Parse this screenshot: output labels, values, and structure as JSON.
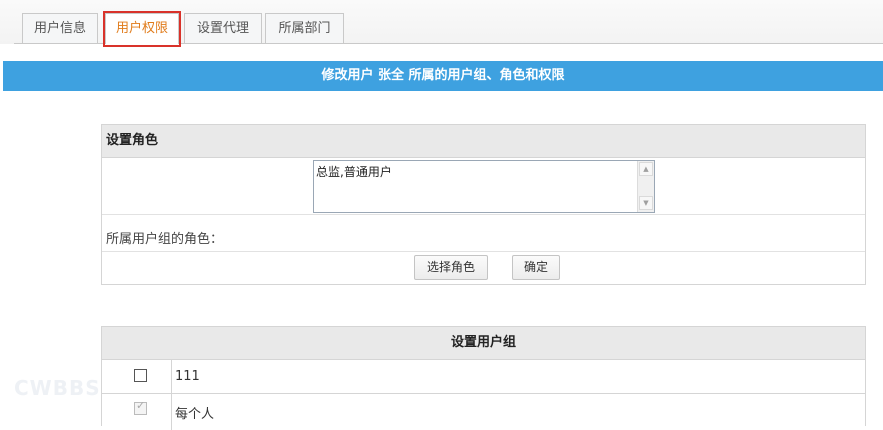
{
  "tabs": [
    {
      "label": "用户信息",
      "active": false
    },
    {
      "label": "用户权限",
      "active": true
    },
    {
      "label": "设置代理",
      "active": false
    },
    {
      "label": "所属部门",
      "active": false
    }
  ],
  "banner": {
    "title": "修改用户 张全 所属的用户组、角色和权限"
  },
  "roles_panel": {
    "heading": "设置角色",
    "roles_value": "总监,普通用户",
    "group_roles_label": "所属用户组的角色：",
    "select_role_button": "选择角色",
    "confirm_button": "确定"
  },
  "groups_panel": {
    "heading": "设置用户组",
    "rows": [
      {
        "name": "111",
        "checked": false,
        "disabled": false
      },
      {
        "name": "每个人",
        "checked": true,
        "disabled": true
      }
    ]
  },
  "watermark": "CWBBS",
  "colors": {
    "accent": "#3ea1e0",
    "active_tab_text": "#e07b1a",
    "highlight": "#d9322a"
  },
  "icons": {
    "scroll_up": "triangle-up",
    "scroll_down": "triangle-down"
  }
}
